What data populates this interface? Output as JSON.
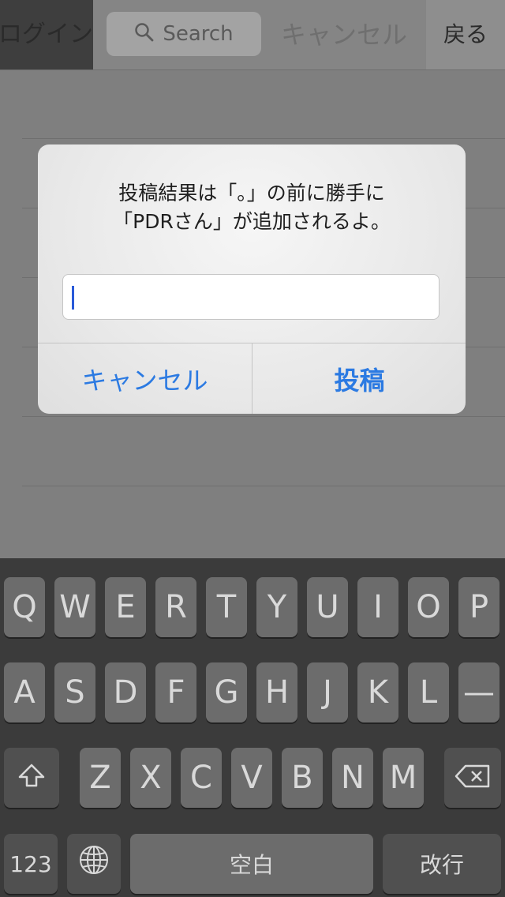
{
  "nav": {
    "left_label": "ログイン",
    "search_placeholder": "Search",
    "cancel_label": "キャンセル",
    "back_label": "戻る"
  },
  "alert": {
    "message_line1": "投稿結果は「。」の前に勝手に",
    "message_line2": "「PDRさん」が追加されるよ。",
    "input_value": "",
    "cancel_button": "キャンセル",
    "post_button": "投稿",
    "accent_color": "#2b7ae2"
  },
  "keyboard": {
    "row1": [
      "Q",
      "W",
      "E",
      "R",
      "T",
      "Y",
      "U",
      "I",
      "O",
      "P"
    ],
    "row2": [
      "A",
      "S",
      "D",
      "F",
      "G",
      "H",
      "J",
      "K",
      "L",
      "—"
    ],
    "row3": [
      "Z",
      "X",
      "C",
      "V",
      "B",
      "N",
      "M"
    ],
    "shift_icon": "shift-arrow-icon",
    "delete_icon": "backspace-icon",
    "numbers_label": "123",
    "globe_icon": "globe-icon",
    "space_label": "空白",
    "return_label": "改行"
  }
}
